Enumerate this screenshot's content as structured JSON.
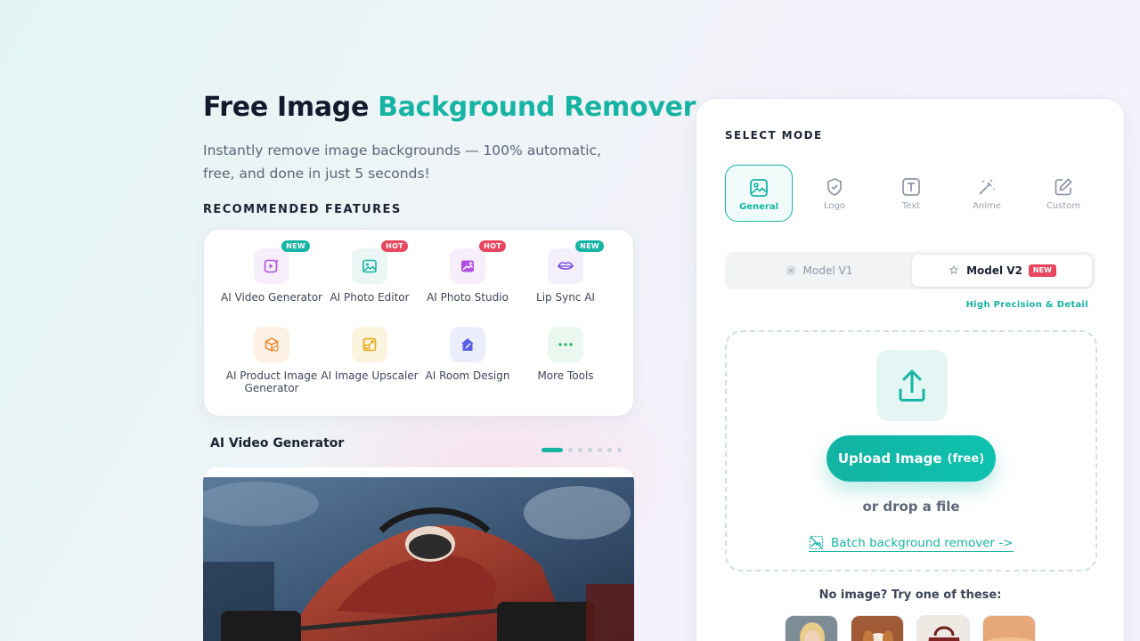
{
  "hero": {
    "title_prefix": "Free Image ",
    "title_accent": "Background Remover",
    "subtitle": "Instantly remove image backgrounds — 100% automatic, free, and done in just 5 seconds!"
  },
  "features": {
    "heading": "RECOMMENDED FEATURES",
    "items": [
      {
        "label": "AI Video Generator",
        "badge": "NEW",
        "icon": "video-sparkle-icon"
      },
      {
        "label": "AI Photo Editor",
        "badge": "HOT",
        "icon": "image-icon"
      },
      {
        "label": "AI Photo Studio",
        "badge": "HOT",
        "icon": "photo-studio-icon"
      },
      {
        "label": "Lip Sync AI",
        "badge": "NEW",
        "icon": "lips-icon"
      },
      {
        "label": "AI Product Image Generator",
        "badge": "",
        "icon": "box-icon"
      },
      {
        "label": "AI Image Upscaler",
        "badge": "",
        "icon": "upscale-icon"
      },
      {
        "label": "AI Room Design",
        "badge": "",
        "icon": "house-icon"
      },
      {
        "label": "More Tools",
        "badge": "",
        "icon": "more-dots-icon"
      }
    ]
  },
  "carousel": {
    "title": "AI Video Generator",
    "slide_count": 7,
    "active_index": 0
  },
  "panel": {
    "select_mode_label": "SELECT MODE",
    "modes": [
      {
        "label": "General",
        "icon": "image-icon",
        "active": true
      },
      {
        "label": "Logo",
        "icon": "shield-check-icon",
        "active": false
      },
      {
        "label": "Text",
        "icon": "text-icon",
        "active": false
      },
      {
        "label": "Anime",
        "icon": "magic-wand-icon",
        "active": false
      },
      {
        "label": "Custom",
        "icon": "edit-icon",
        "active": false
      }
    ],
    "models": {
      "v1_label": "Model V1",
      "v2_label": "Model V2",
      "v2_badge": "NEW",
      "selected": "Model V2"
    },
    "precision_note": "High Precision & Detail",
    "upload": {
      "button_label": "Upload Image",
      "button_suffix": "(free)",
      "drop_text": "or drop a file",
      "batch_link": "Batch background remover ->"
    },
    "samples_heading": "No image? Try one of these:"
  },
  "colors": {
    "accent": "#17b4a3",
    "hot": "#e8475f"
  }
}
